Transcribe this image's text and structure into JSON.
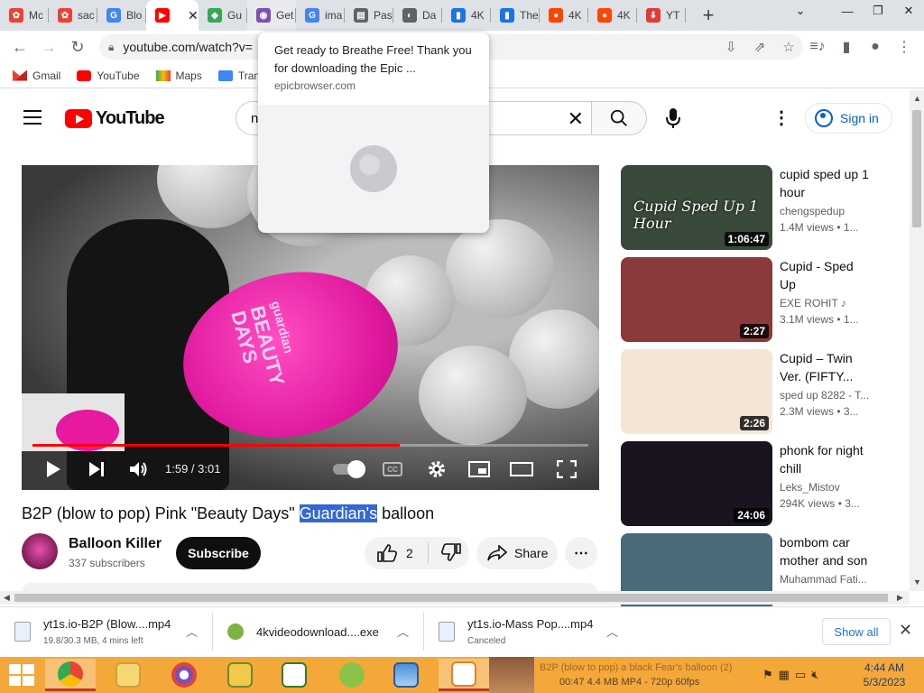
{
  "browser": {
    "tabs": [
      {
        "label": "Mc",
        "color": "#ea4335",
        "glyph": "✿"
      },
      {
        "label": "sac",
        "color": "#ea4335",
        "glyph": "✿"
      },
      {
        "label": "Blo",
        "color": "#4285f4",
        "glyph": "G"
      },
      {
        "label": "",
        "color": "#ff0000",
        "glyph": "▶"
      },
      {
        "label": "Gu",
        "color": "#34a853",
        "glyph": "◆"
      },
      {
        "label": "Get",
        "color": "#7b4fb5",
        "glyph": "◉"
      },
      {
        "label": "ima",
        "color": "#4285f4",
        "glyph": "G"
      },
      {
        "label": "Pas",
        "color": "#5f6368",
        "glyph": "▤"
      },
      {
        "label": "Da",
        "color": "#5f6368",
        "glyph": "◐"
      },
      {
        "label": "4K",
        "color": "#1a73e8",
        "glyph": "▮"
      },
      {
        "label": "The",
        "color": "#1a73e8",
        "glyph": "▮"
      },
      {
        "label": "4K",
        "color": "#ff4500",
        "glyph": "●"
      },
      {
        "label": "4K",
        "color": "#ff4500",
        "glyph": "●"
      },
      {
        "label": "YT",
        "color": "#e53935",
        "glyph": "⬇"
      }
    ],
    "url": "youtube.com/watch?v=",
    "bookmarks": [
      "Gmail",
      "YouTube",
      "Maps",
      "Tran"
    ]
  },
  "popup": {
    "title": "Get ready to Breathe Free! Thank you for downloading the Epic ...",
    "url": "epicbrowser.com"
  },
  "youtube": {
    "logo": "YouTube",
    "search_value": "n",
    "signin": "Sign in"
  },
  "player": {
    "time": "1:59 / 3:01",
    "progress": 0.66,
    "thumb_text_1": "guardian",
    "thumb_text_2": "BEAUTY",
    "thumb_text_3": "DAYS"
  },
  "video": {
    "title_before": "B2P (blow to pop) Pink \"Beauty Days\" ",
    "title_highlight": "Guardian's",
    "title_after": " balloon",
    "channel": "Balloon Killer",
    "subscribers": "337 subscribers",
    "subscribe": "Subscribe",
    "likes": "2",
    "share": "Share"
  },
  "recommendations": [
    {
      "title_1": "cupid sped up 1",
      "title_2": "hour",
      "channel": "chengspedup",
      "meta": "1.4M views  •  1...",
      "duration": "1:06:47",
      "thumb_text": "Cupid Sped Up 1 Hour",
      "bg": "#3a4a3a"
    },
    {
      "title_1": "Cupid - Sped",
      "title_2": "Up",
      "channel": "EXE ROHIT ♪",
      "meta": "3.1M views  •  1...",
      "duration": "2:27",
      "thumb_text": "",
      "bg": "#8a3a3a"
    },
    {
      "title_1": "Cupid – Twin",
      "title_2": "Ver. (FIFTY...",
      "channel": "sped up 8282 - T...",
      "meta": "2.3M views  •  3...",
      "duration": "2:26",
      "thumb_text": "",
      "bg": "#f3e6d6"
    },
    {
      "title_1": "phonk for night",
      "title_2": "chill",
      "channel": "Leks_Mistov",
      "meta": "294K views  •  3...",
      "duration": "24:06",
      "thumb_text": "",
      "bg": "#1a1420"
    },
    {
      "title_1": "bombom car",
      "title_2": "mother and son",
      "channel": "Muhammad Fati...",
      "meta": "",
      "duration": "",
      "thumb_text": "",
      "bg": "#4a6a7a"
    }
  ],
  "downloads": [
    {
      "name": "yt1s.io-B2P (Blow....mp4",
      "status": "19.8/30.3 MB, 4 mins left"
    },
    {
      "name": "4kvideodownload....exe",
      "status": ""
    },
    {
      "name": "yt1s.io-Mass Pop....mp4",
      "status": "Canceled"
    }
  ],
  "show_all": "Show all",
  "taskbar": {
    "media_title": "B2P (blow to pop) a black Fear's balloon (2)",
    "media_stats": "00:47    4.4 MB    MP4 - 720p 60fps",
    "time": "4:44 AM",
    "date": "5/3/2023"
  }
}
